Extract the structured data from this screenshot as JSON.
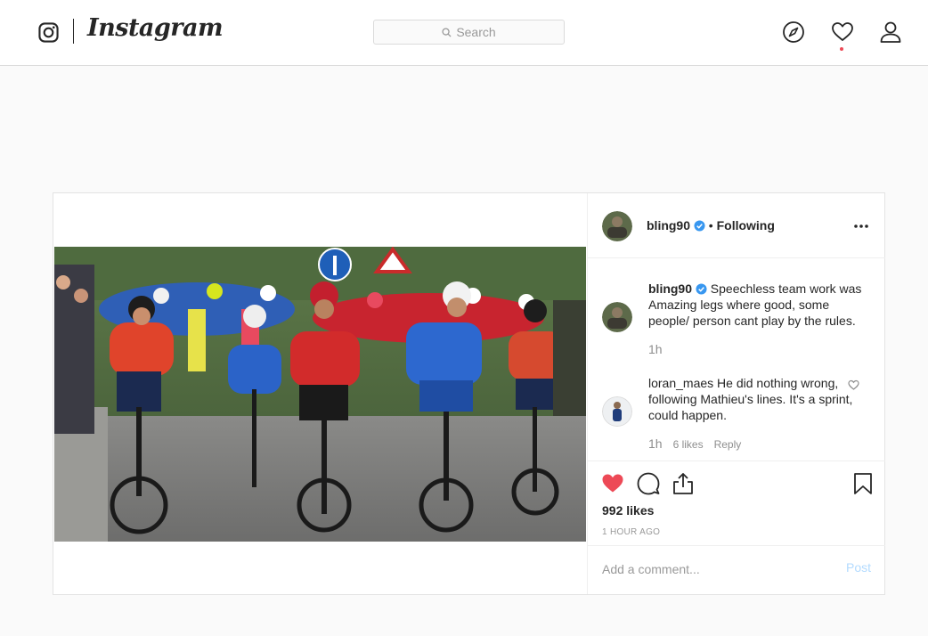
{
  "header": {
    "brand": "Instagram",
    "search_placeholder": "Search",
    "icons": [
      "instagram-logo-icon",
      "search-icon",
      "compass-icon",
      "heart-icon",
      "profile-icon"
    ]
  },
  "post": {
    "author": "bling90",
    "author_verified": true,
    "follow_sep": "•",
    "follow_status": "Following",
    "caption": {
      "username": "bling90",
      "text": "Speechless team work was Amazing legs where good, some people/ person cant play by the rules.",
      "time": "1h"
    },
    "comments": [
      {
        "username": "loran_maes",
        "text": "He did nothing wrong, following Mathieu's lines. It's a sprint, could happen.",
        "time": "1h",
        "likes": "6 likes",
        "reply": "Reply"
      }
    ],
    "likes": "992 likes",
    "posted": "1 HOUR AGO",
    "add_comment_placeholder": "Add a comment...",
    "post_label": "Post",
    "liked": true
  },
  "colors": {
    "accent_like": "#ed4956",
    "verified_blue": "#3897f0",
    "post_button_disabled": "#b3dbff"
  }
}
